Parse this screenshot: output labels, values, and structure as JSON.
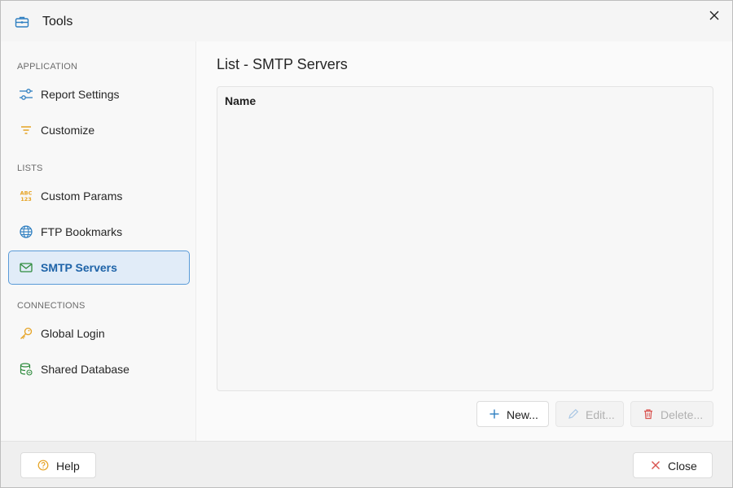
{
  "window": {
    "title": "Tools",
    "title_icon": "toolbox-icon",
    "close_icon": "close-icon"
  },
  "sidebar": {
    "sections": [
      {
        "header": "APPLICATION",
        "items": [
          {
            "label": "Report Settings",
            "icon": "sliders-icon",
            "active": false
          },
          {
            "label": "Customize",
            "icon": "filter-icon",
            "active": false
          }
        ]
      },
      {
        "header": "LISTS",
        "items": [
          {
            "label": "Custom Params",
            "icon": "abc-123-icon",
            "icon_text_top": "ABC",
            "icon_text_bottom": "123",
            "active": false
          },
          {
            "label": "FTP Bookmarks",
            "icon": "globe-icon",
            "active": false
          },
          {
            "label": "SMTP Servers",
            "icon": "envelope-icon",
            "active": true
          }
        ]
      },
      {
        "header": "CONNECTIONS",
        "items": [
          {
            "label": "Global Login",
            "icon": "key-icon",
            "active": false
          },
          {
            "label": "Shared Database",
            "icon": "database-icon",
            "active": false
          }
        ]
      }
    ]
  },
  "main": {
    "title": "List - SMTP Servers",
    "list": {
      "columns": [
        "Name"
      ],
      "rows": []
    },
    "actions": {
      "new_label": "New...",
      "edit_label": "Edit...",
      "delete_label": "Delete..."
    }
  },
  "footer": {
    "help_label": "Help",
    "close_label": "Close"
  },
  "colors": {
    "accent": "#1e63a8",
    "active_bg": "#e1ecf8",
    "active_border": "#5a9bd8",
    "icon_blue": "#2f7fc1",
    "icon_orange": "#e6a323",
    "icon_green": "#2e8b3d",
    "delete_red": "#d9534f"
  }
}
